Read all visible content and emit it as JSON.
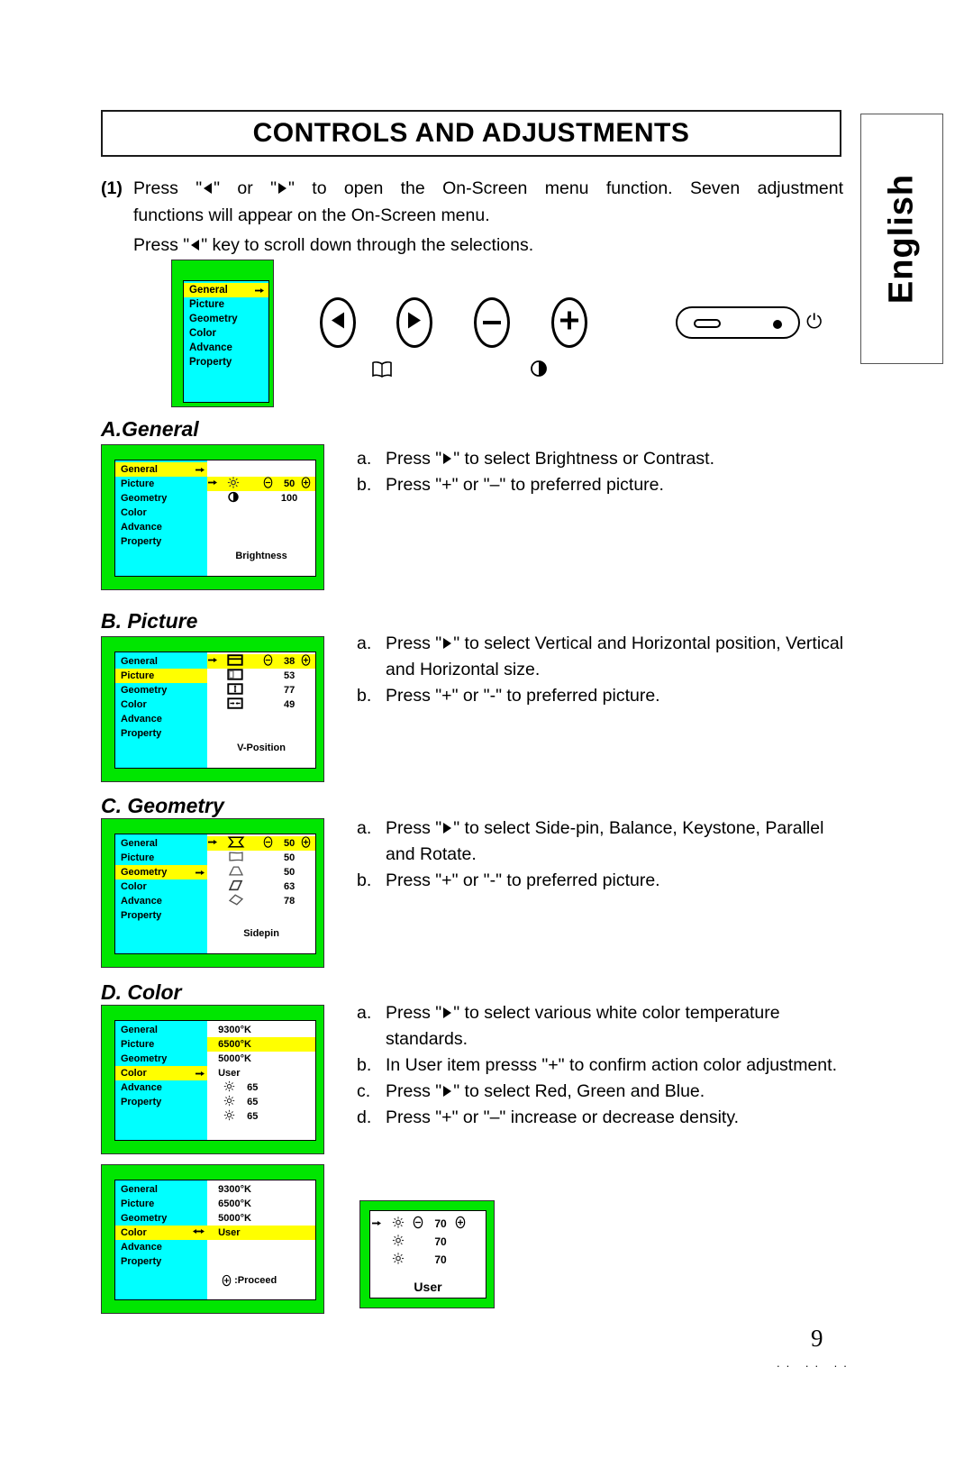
{
  "page": {
    "title": "CONTROLS AND ADJUSTMENTS",
    "language_tab": "English",
    "page_number": "9",
    "footer_marks": ".. .. .."
  },
  "intro": {
    "step_number": "(1)",
    "line1_a": "Press \"",
    "line1_b": "\" or \"",
    "line1_c": "\" to open the On-Screen menu function. Seven adjustment",
    "line2": "functions will appear on the On-Screen menu.",
    "line3_a": "Press \"",
    "line3_b": "\" key to scroll down through the selections."
  },
  "menu_items": [
    "General",
    "Picture",
    "Geometry",
    "Color",
    "Advance",
    "Property"
  ],
  "controls": {
    "left_button": "left-arrow",
    "right_button": "right-arrow",
    "minus_button": "minus",
    "plus_button": "plus",
    "book_icon": "book-icon",
    "contrast_icon": "contrast-icon",
    "power_switch": "power-switch",
    "led_indicator": "led-indicator",
    "power_symbol": "⏻"
  },
  "osd_top": {
    "highlighted": "General",
    "cursor": "◄"
  },
  "sections": [
    {
      "id": "general",
      "heading": "A.General",
      "osd": {
        "highlighted_menu": "General",
        "active_row_index": 1,
        "rows": [
          {
            "icon": "sun-icon",
            "value": "50",
            "has_controls": true
          },
          {
            "icon": "contrast-icon",
            "value": "100",
            "has_controls": false
          }
        ],
        "caption": "Brightness"
      },
      "instructions": [
        {
          "label": "a.",
          "pre": "Press \"",
          "post": "\" to select Brightness or Contrast.",
          "has_arrow": true
        },
        {
          "label": "b.",
          "pre": "Press \"+\" or \"–\" to preferred picture.",
          "post": "",
          "has_arrow": false
        }
      ]
    },
    {
      "id": "picture",
      "heading": "B. Picture",
      "osd": {
        "highlighted_menu": "Picture",
        "active_row_index": 0,
        "rows": [
          {
            "icon": "v-position-icon",
            "value": "38",
            "has_controls": true
          },
          {
            "icon": "h-position-icon",
            "value": "53",
            "has_controls": false
          },
          {
            "icon": "v-size-icon",
            "value": "77",
            "has_controls": false
          },
          {
            "icon": "h-size-icon",
            "value": "49",
            "has_controls": false
          }
        ],
        "caption": "V-Position"
      },
      "instructions": [
        {
          "label": "a.",
          "pre": "Press \"",
          "post": "\" to select Vertical and Horizontal position, Vertical and Horizontal size.",
          "has_arrow": true
        },
        {
          "label": "b.",
          "pre": "Press \"+\" or \"-\" to preferred picture.",
          "post": "",
          "has_arrow": false
        }
      ]
    },
    {
      "id": "geometry",
      "heading": "C. Geometry",
      "osd": {
        "highlighted_menu": "Geometry",
        "active_row_index": 0,
        "rows": [
          {
            "icon": "side-pin-icon",
            "value": "50",
            "has_controls": true
          },
          {
            "icon": "balance-icon",
            "value": "50",
            "has_controls": false
          },
          {
            "icon": "keystone-icon",
            "value": "50",
            "has_controls": false
          },
          {
            "icon": "parallel-icon",
            "value": "63",
            "has_controls": false
          },
          {
            "icon": "rotate-icon",
            "value": "78",
            "has_controls": false
          }
        ],
        "caption": "Sidepin"
      },
      "instructions": [
        {
          "label": "a.",
          "pre": "Press \"",
          "post": "\" to select Side-pin, Balance, Keystone, Parallel and Rotate.",
          "has_arrow": true
        },
        {
          "label": "b.",
          "pre": "Press \"+\" or \"-\" to preferred picture.",
          "post": "",
          "has_arrow": false
        }
      ]
    },
    {
      "id": "color",
      "heading": "D. Color",
      "osd": {
        "highlighted_menu": "Color",
        "temps": [
          "9300°K",
          "6500°K",
          "5000°K",
          "User"
        ],
        "highlighted_temp": "6500°K",
        "rgb_rows": [
          {
            "icon": "sun-icon",
            "value": "65"
          },
          {
            "icon": "sun-icon",
            "value": "65"
          },
          {
            "icon": "sun-icon",
            "value": "65"
          }
        ]
      },
      "instructions": [
        {
          "label": "a.",
          "pre": "Press \"",
          "post": "\" to select various white color temperature standards.",
          "has_arrow": true
        },
        {
          "label": "b.",
          "pre": "In User item presss \"+\" to confirm action color adjustment.",
          "post": "",
          "has_arrow": false
        },
        {
          "label": "c.",
          "pre": "Press \"",
          "post": "\" to select Red, Green and Blue.",
          "has_arrow": true
        },
        {
          "label": "d.",
          "pre": "Press \"+\" or \"–\" increase or decrease density.",
          "post": "",
          "has_arrow": false
        }
      ]
    }
  ],
  "color_user_panel": {
    "temps": [
      "9300°K",
      "6500°K",
      "5000°K",
      "User"
    ],
    "highlighted_menu": "Color",
    "highlighted_temp": "User",
    "proceed_label": ":Proceed",
    "proceed_icon": "plus-icon"
  },
  "user_panel": {
    "rows": [
      {
        "icon": "sun-icon",
        "value": "70",
        "has_controls": true
      },
      {
        "icon": "sun-icon",
        "value": "70",
        "has_controls": false
      },
      {
        "icon": "sun-icon",
        "value": "70",
        "has_controls": false
      }
    ],
    "caption": "User"
  }
}
